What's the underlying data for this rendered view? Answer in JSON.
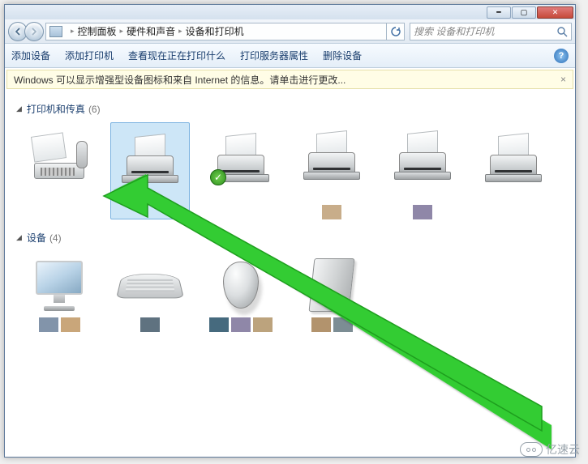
{
  "breadcrumb": {
    "l1": "控制面板",
    "l2": "硬件和声音",
    "l3": "设备和打印机"
  },
  "search": {
    "placeholder": "搜索 设备和打印机"
  },
  "toolbar": {
    "add_device": "添加设备",
    "add_printer": "添加打印机",
    "view_queue": "查看现在正在打印什么",
    "server_props": "打印服务器属性",
    "remove_device": "删除设备"
  },
  "infobar": {
    "msg": "Windows 可以显示增强型设备图标和来自 Internet 的信息。请单击进行更改...",
    "close": "×"
  },
  "groups": {
    "printers": {
      "title": "打印机和传真",
      "count": "(6)"
    },
    "devices": {
      "title": "设备",
      "count": "(4)"
    }
  },
  "swatches": {
    "p4": "#c8ad8a",
    "p5": "#8f87a8",
    "d1a": "#8294aa",
    "d1b": "#c9a67a",
    "d2a": "#5f7280",
    "d3a": "#466a7e",
    "d3b": "#8f87a8",
    "d3c": "#bca37d",
    "d4a": "#b2936d",
    "d4b": "#7c8d94"
  },
  "watermark": "亿速云"
}
